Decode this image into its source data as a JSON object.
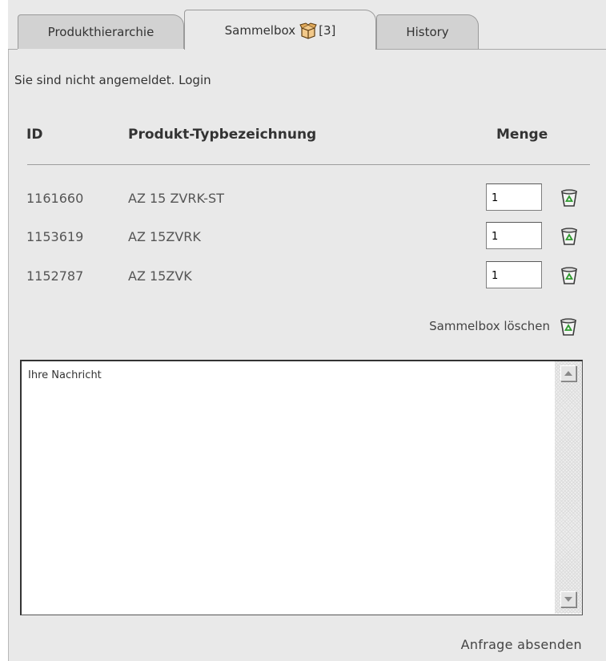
{
  "tabs": [
    {
      "label": "Produkthierarchie"
    },
    {
      "label": "Sammelbox",
      "count": "[3]",
      "icon": "box-icon"
    },
    {
      "label": "History"
    }
  ],
  "login_text": "Sie sind nicht angemeldet. Login",
  "table": {
    "headers": {
      "id": "ID",
      "name": "Produkt-Typbezeichnung",
      "qty": "Menge"
    },
    "rows": [
      {
        "id": "1161660",
        "name": "AZ 15 ZVRK-ST",
        "qty": "1"
      },
      {
        "id": "1153619",
        "name": "AZ 15ZVRK",
        "qty": "1"
      },
      {
        "id": "1152787",
        "name": "AZ 15ZVK",
        "qty": "1"
      }
    ]
  },
  "clear_label": "Sammelbox löschen",
  "message": {
    "text": "Ihre Nachricht"
  },
  "submit_label": "Anfrage absenden",
  "colors": {
    "panel": "#e9e9e9",
    "tab_inactive": "#d2d2d2",
    "trash_green": "#2e9a2e"
  }
}
